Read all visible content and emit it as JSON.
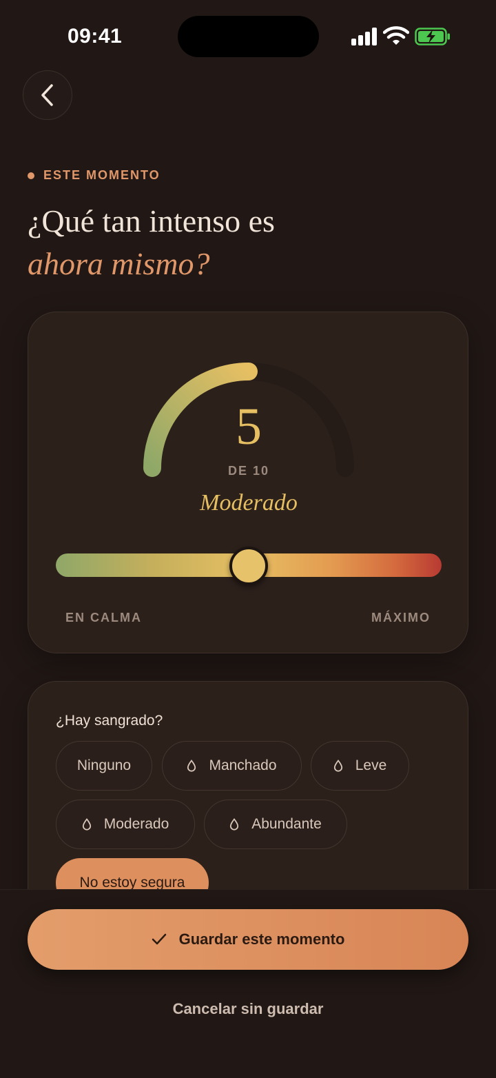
{
  "status_bar": {
    "time": "09:41",
    "icons": [
      "signal-icon",
      "wifi-icon",
      "battery-charging-icon"
    ]
  },
  "header": {
    "back_icon": "chevron-left-icon"
  },
  "eyebrow": "ESTE MOMENTO",
  "heading": {
    "line1": "¿Qué tan intenso es",
    "line2": "ahora mismo?"
  },
  "intensity": {
    "value": "5",
    "of_label": "DE 10",
    "level_label": "Moderado",
    "min_label": "EN CALMA",
    "max_label": "MÁXIMO",
    "fraction": 0.5
  },
  "bleeding": {
    "question": "¿Hay sangrado?",
    "options": [
      {
        "label": "Ninguno",
        "icon": ""
      },
      {
        "label": "Manchado",
        "icon": "drop-icon"
      },
      {
        "label": "Leve",
        "icon": "drop-icon"
      },
      {
        "label": "Moderado",
        "icon": "drop-icon"
      },
      {
        "label": "Abundante",
        "icon": "drop-icon"
      },
      {
        "label": "No estoy segura",
        "icon": ""
      }
    ],
    "selected": "No estoy segura"
  },
  "actions": {
    "save_label": "Guardar este momento",
    "save_icon": "check-icon",
    "cancel_label": "Cancelar sin guardar"
  },
  "colors": {
    "background": "#211815",
    "accent": "#e0976a",
    "gold": "#e6bf63",
    "card": "#2c201b"
  }
}
